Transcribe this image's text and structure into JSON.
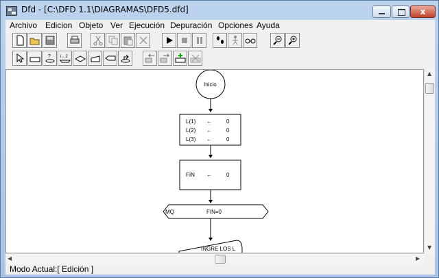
{
  "window": {
    "title": "Dfd - [C:\\DFD 1.1\\DIAGRAMAS\\DFD5.dfd]",
    "close_glyph": "x"
  },
  "menu": [
    "Archivo",
    "Edicion",
    "Objeto",
    "Ver",
    "Ejecución",
    "Depuración",
    "Opciones",
    "Ayuda"
  ],
  "toolbar_row1": [
    {
      "icon": "new-document-icon"
    },
    {
      "icon": "open-folder-icon"
    },
    {
      "icon": "save-icon"
    },
    {
      "icon": "print-icon"
    },
    {
      "icon": "cut-icon"
    },
    {
      "icon": "copy-icon"
    },
    {
      "icon": "paste-icon"
    },
    {
      "icon": "delete-icon"
    },
    {
      "icon": "run-icon"
    },
    {
      "icon": "stop-icon"
    },
    {
      "icon": "pause-icon"
    },
    {
      "icon": "step-icon"
    },
    {
      "icon": "trace-icon"
    },
    {
      "icon": "watch-icon"
    },
    {
      "icon": "zoom-out-icon"
    },
    {
      "icon": "zoom-in-icon"
    }
  ],
  "toolbar_row2": [
    {
      "icon": "pointer-icon"
    },
    {
      "icon": "assign-shape-icon"
    },
    {
      "icon": "read-shape-icon"
    },
    {
      "icon": "for-loop-icon"
    },
    {
      "icon": "decision-icon"
    },
    {
      "icon": "read-input-icon"
    },
    {
      "icon": "write-output-icon"
    },
    {
      "icon": "subprogram-icon"
    },
    {
      "icon": "cursor-left-icon"
    },
    {
      "icon": "cursor-right-icon"
    },
    {
      "icon": "insert-icon"
    },
    {
      "icon": "remove-icon"
    }
  ],
  "flowchart": {
    "start_label": "Inicio",
    "assign1": [
      {
        "var": "L(1)",
        "arrow": "←",
        "val": "0"
      },
      {
        "var": "L(2)",
        "arrow": "←",
        "val": "0"
      },
      {
        "var": "L(3)",
        "arrow": "←",
        "val": "0"
      }
    ],
    "assign2": {
      "var": "FIN",
      "arrow": "←",
      "val": "0"
    },
    "loop": {
      "label": "MQ",
      "cond": "FIN=0"
    },
    "read_label": "INGRE LOS L"
  },
  "status": {
    "text": "Modo Actual:[ Edición ]"
  },
  "colors": {
    "title_gradient_top": "#bcd3ee",
    "close_button": "#c2442d",
    "canvas": "#ffffff"
  }
}
